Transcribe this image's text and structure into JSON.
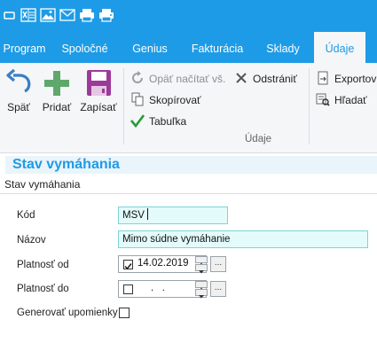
{
  "quick_access": {
    "icons": [
      "window-icon",
      "excel-icon",
      "image-icon",
      "email-icon",
      "print-icon",
      "print-preview-icon"
    ]
  },
  "tabs": [
    {
      "label": "Program",
      "active": false
    },
    {
      "label": "Spoločné",
      "active": false
    },
    {
      "label": "Genius",
      "active": false
    },
    {
      "label": "Fakturácia",
      "active": false
    },
    {
      "label": "Sklady",
      "active": false
    },
    {
      "label": "Údaje",
      "active": true
    }
  ],
  "ribbon": {
    "back_label": "Späť",
    "add_label": "Pridať",
    "save_label": "Zapísať",
    "reload_label": "Opäť načítať vš.",
    "delete_label": "Odstrániť",
    "copy_label": "Skopírovať",
    "table_label": "Tabuľka",
    "export_label": "Exportov",
    "search_label": "Hľadať",
    "group_label": "Údaje"
  },
  "section": {
    "title": "Stav vymáhania",
    "subtitle": "Stav vymáhania"
  },
  "form": {
    "kod_label": "Kód",
    "kod_value": "MSV",
    "nazov_label": "Názov",
    "nazov_value": "Mimo súdne vymáhanie",
    "platnost_od_label": "Platnosť od",
    "platnost_od_value": "14.02.2019",
    "platnost_od_checked": true,
    "platnost_do_label": "Platnosť do",
    "platnost_do_value": ".   .",
    "platnost_do_checked": false,
    "generovat_label": "Generovať upomienky",
    "generovat_checked": false
  },
  "colors": {
    "accent": "#1e9be6",
    "field_bg": "#e3fbfb",
    "add_green": "#5fa86b",
    "save_purple": "#9c3a9a"
  }
}
